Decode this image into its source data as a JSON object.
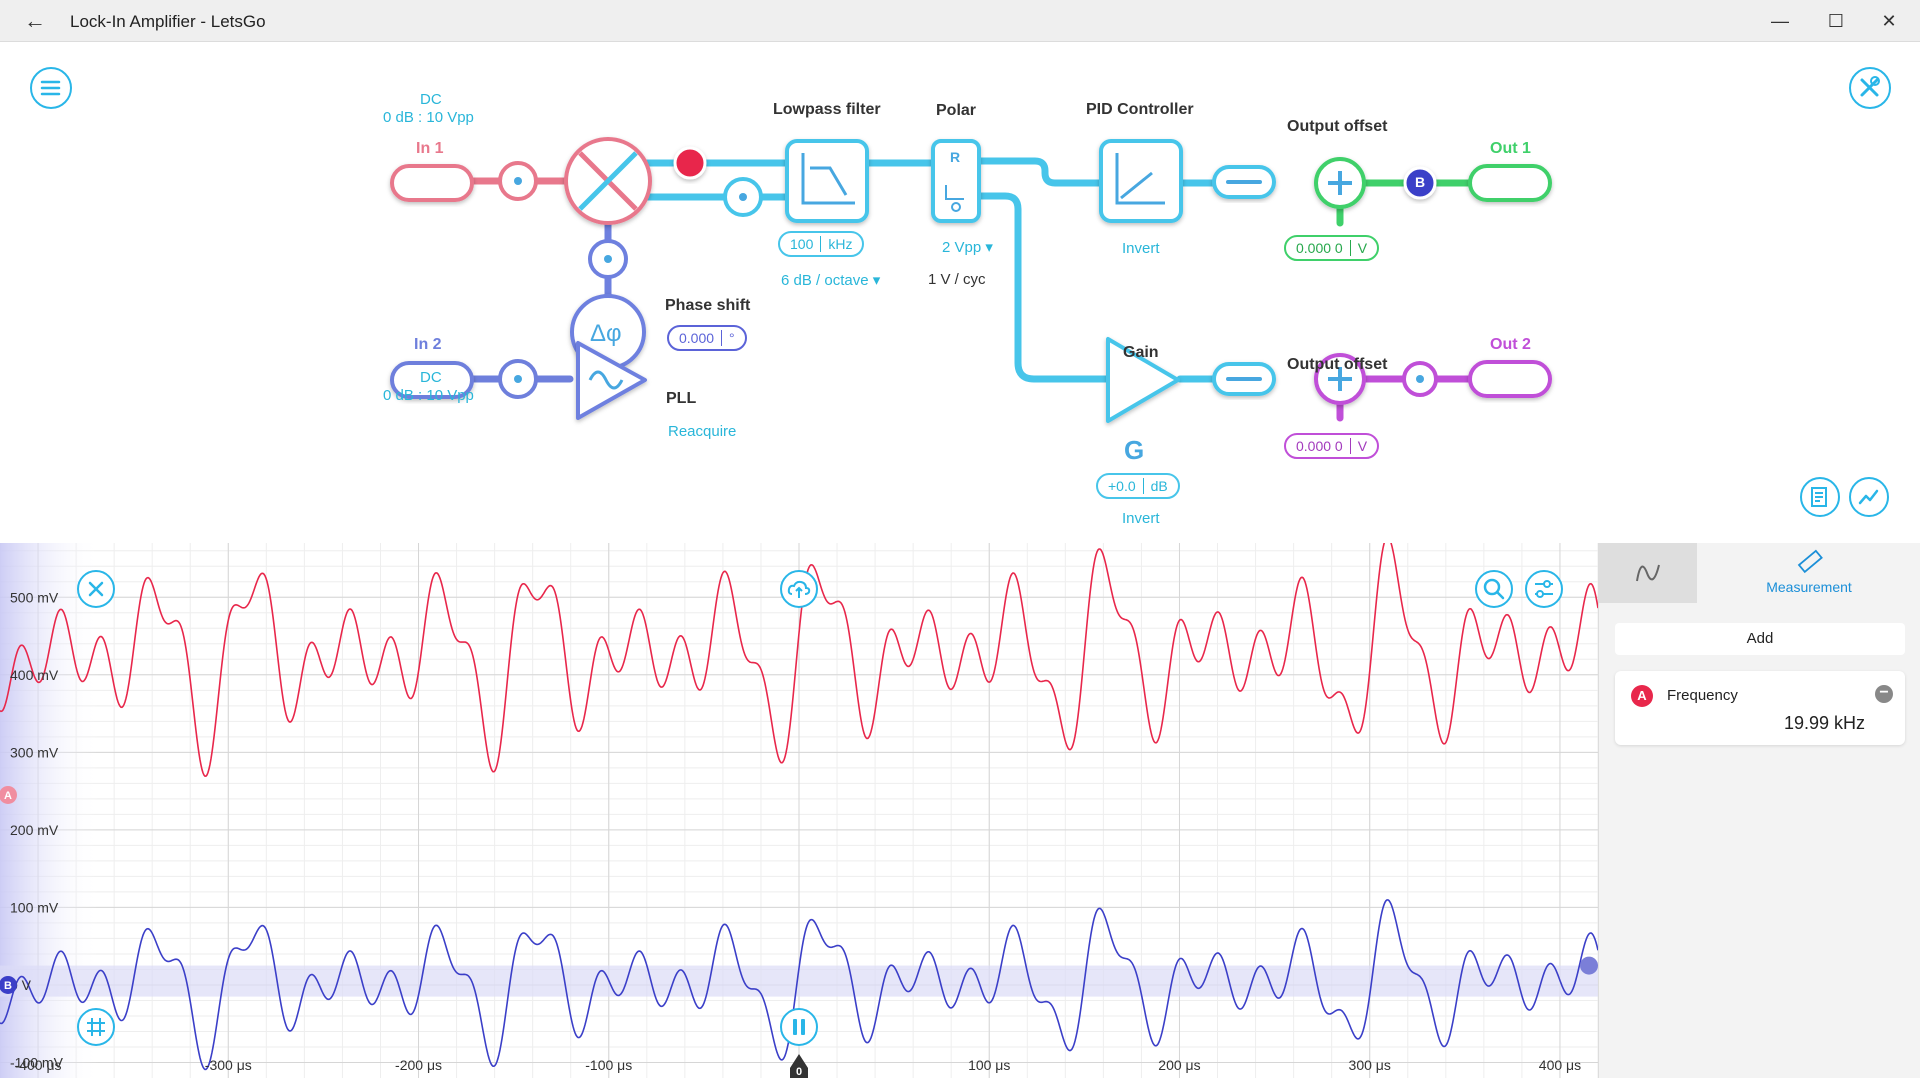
{
  "window": {
    "title": "Lock-In Amplifier - LetsGo",
    "back_glyph": "←",
    "minimize_glyph": "—",
    "maximize_glyph": "☐",
    "close_glyph": "✕"
  },
  "diagram": {
    "in1": {
      "label": "In 1",
      "coupling": "DC",
      "range": "0 dB : 10 Vpp"
    },
    "in2": {
      "label": "In 2",
      "coupling": "DC",
      "range": "0 dB : 10 Vpp"
    },
    "mixer_probe": "A",
    "lowpass": {
      "title": "Lowpass filter",
      "cutoff_value": "100",
      "cutoff_unit": "kHz",
      "slope": "6 dB / octave"
    },
    "polar": {
      "title": "Polar",
      "symbol": "R",
      "range": "2 Vpp",
      "scale": "1 V / cyc"
    },
    "phase_shift": {
      "title": "Phase shift",
      "symbol": "Δφ",
      "value": "0.000",
      "unit": "°"
    },
    "pll": {
      "title": "PLL",
      "action": "Reacquire"
    },
    "pid": {
      "title": "PID Controller",
      "invert": "Invert"
    },
    "gain": {
      "title": "Gain",
      "symbol": "G",
      "value": "+0.0",
      "unit": "dB",
      "invert": "Invert"
    },
    "offset1": {
      "title": "Output offset",
      "value": "0.000 0",
      "unit": "V"
    },
    "offset2": {
      "title": "Output offset",
      "value": "0.000 0",
      "unit": "V"
    },
    "out1": {
      "label": "Out 1",
      "probe": "B"
    },
    "out2": {
      "label": "Out 2"
    }
  },
  "colors": {
    "red": "#e8274b",
    "blue": "#3b3fc8",
    "cyan": "#47c5ea",
    "green": "#3fd06a",
    "purple": "#c04fd8"
  },
  "chart_data": {
    "type": "line",
    "x_label_unit": "μs",
    "xlim": [
      -420,
      420
    ],
    "x_ticks": [
      "-400 μs",
      "-300 μs",
      "-200 μs",
      "-100 μs",
      "0",
      "100 μs",
      "200 μs",
      "300 μs",
      "400 μs"
    ],
    "x_tick_values": [
      -400,
      -300,
      -200,
      -100,
      0,
      100,
      200,
      300,
      400
    ],
    "ylim": [
      -120,
      570
    ],
    "y_ticks": [
      "500 mV",
      "400 mV",
      "300 mV",
      "200 mV",
      "100 mV",
      "0 V",
      "-100 mV"
    ],
    "y_tick_values": [
      500,
      400,
      300,
      200,
      100,
      0,
      -100
    ],
    "grid": true,
    "series": [
      {
        "name": "A",
        "color": "#e8274b",
        "offset_mv": 430,
        "amplitude_mv": 120,
        "carrier_khz": 20,
        "beat_khz": 6.5
      },
      {
        "name": "B",
        "color": "#3b3fc8",
        "offset_mv": 5,
        "amplitude_mv": 85,
        "carrier_khz": 20,
        "beat_khz": 6.5
      }
    ],
    "markers": {
      "a": "A",
      "b": "B",
      "trigger": "0"
    }
  },
  "panel": {
    "tab_wave_icon": "sine-wave-icon",
    "tab_measurement": "Measurement",
    "add_label": "Add",
    "measurements": [
      {
        "channel": "A",
        "name": "Frequency",
        "value": "19.99 kHz"
      }
    ]
  }
}
